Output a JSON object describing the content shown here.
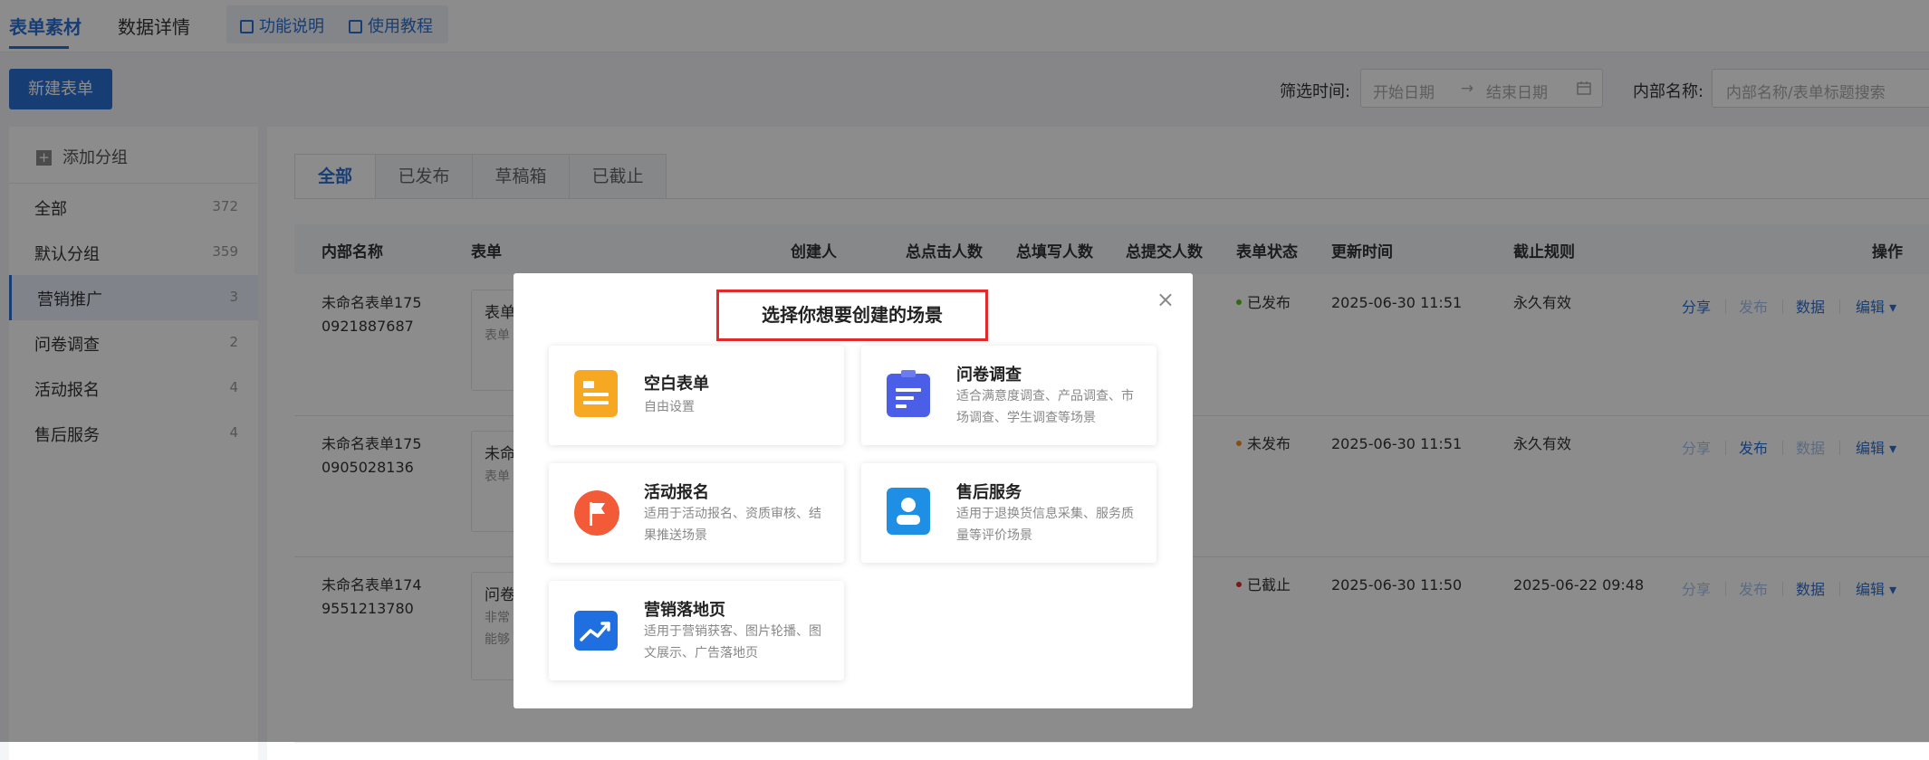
{
  "topbar": {
    "tabs": [
      "表单素材",
      "数据详情"
    ],
    "help_links": [
      "功能说明",
      "使用教程"
    ]
  },
  "toolbar": {
    "new_form_label": "新建表单",
    "filter_time_label": "筛选时间:",
    "start_date_placeholder": "开始日期",
    "arrow": "→",
    "end_date_placeholder": "结束日期",
    "internal_name_label": "内部名称:",
    "search_placeholder": "内部名称/表单标题搜索"
  },
  "sidebar": {
    "add_group_label": "添加分组",
    "items": [
      {
        "label": "全部",
        "count": "372"
      },
      {
        "label": "默认分组",
        "count": "359"
      },
      {
        "label": "营销推广",
        "count": "3"
      },
      {
        "label": "问卷调查",
        "count": "2"
      },
      {
        "label": "活动报名",
        "count": "4"
      },
      {
        "label": "售后服务",
        "count": "4"
      }
    ],
    "active_index": 2
  },
  "subtabs": [
    "全部",
    "已发布",
    "草稿箱",
    "已截止"
  ],
  "table": {
    "headers": [
      "内部名称",
      "表单",
      "创建人",
      "总点击人数",
      "总填写人数",
      "总提交人数",
      "表单状态",
      "更新时间",
      "截止规则",
      "操作"
    ],
    "rows": [
      {
        "name_line1": "未命名表单175",
        "name_line2": "0921887687",
        "form_title": "表单",
        "form_sub": "表单",
        "form_sub2": "",
        "status": "已发布",
        "status_color": "#52c41a",
        "updated": "2025-06-30 11:51",
        "deadline": "永久有效",
        "ops": [
          "分享",
          "发布",
          "数据",
          "编辑 ▾"
        ],
        "ops_enabled": [
          true,
          false,
          true,
          true
        ]
      },
      {
        "name_line1": "未命名表单175",
        "name_line2": "0905028136",
        "form_title": "未命",
        "form_sub": "表单",
        "form_sub2": "",
        "status": "未发布",
        "status_color": "#fa8c16",
        "updated": "2025-06-30 11:51",
        "deadline": "永久有效",
        "ops": [
          "分享",
          "发布",
          "数据",
          "编辑 ▾"
        ],
        "ops_enabled": [
          false,
          true,
          false,
          true
        ]
      },
      {
        "name_line1": "未命名表单174",
        "name_line2": "9551213780",
        "form_title": "问卷",
        "form_sub": "非常",
        "form_sub2": "能够",
        "status": "已截止",
        "status_color": "#e22a2a",
        "updated": "2025-06-30 11:50",
        "deadline": "2025-06-22 09:48",
        "ops": [
          "分享",
          "发布",
          "数据",
          "编辑 ▾"
        ],
        "ops_enabled": [
          false,
          false,
          true,
          true
        ]
      }
    ]
  },
  "modal": {
    "title": "选择你想要创建的场景",
    "close": "×",
    "cards": [
      {
        "title": "空白表单",
        "desc": "自由设置",
        "icon": "blank-form-icon",
        "color": "#f7a823"
      },
      {
        "title": "问卷调查",
        "desc": "适合满意度调查、产品调查、市场调查、学生调查等场景",
        "icon": "survey-clipboard-icon",
        "color": "#4a5ee8"
      },
      {
        "title": "活动报名",
        "desc": "适用于活动报名、资质审核、结果推送场景",
        "icon": "flag-icon",
        "color": "#f25a38"
      },
      {
        "title": "售后服务",
        "desc": "适用于退换货信息采集、服务质量等评价场景",
        "icon": "user-badge-icon",
        "color": "#1f8fe6"
      },
      {
        "title": "营销落地页",
        "desc": "适用于营销获客、图片轮播、图文展示、广告落地页",
        "icon": "trend-chart-icon",
        "color": "#1f6fe0"
      }
    ]
  }
}
